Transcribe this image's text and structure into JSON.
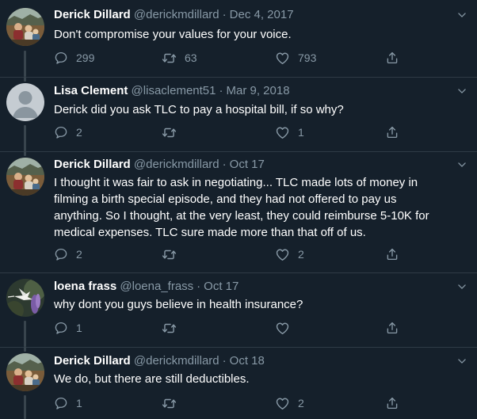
{
  "tweets": [
    {
      "display_name": "Derick Dillard",
      "handle": "@derickmdillard",
      "separator": "·",
      "date": "Dec 4, 2017",
      "text": "Don't compromise your values for your voice.",
      "replies": "299",
      "retweets": "63",
      "likes": "793",
      "avatar": "derick-avatar"
    },
    {
      "display_name": "Lisa Clement",
      "handle": "@lisaclement51",
      "separator": "·",
      "date": "Mar 9, 2018",
      "text": "Derick did you ask TLC to pay a hospital bill, if so why?",
      "replies": "2",
      "retweets": "",
      "likes": "1",
      "avatar": "default-avatar"
    },
    {
      "display_name": "Derick Dillard",
      "handle": "@derickmdillard",
      "separator": "·",
      "date": "Oct 17",
      "text": "I thought it was fair to ask in negotiating... TLC made lots of money in\nfilming a birth special episode, and they had not offered to pay us\nanything.  So I thought, at the very least, they could reimburse 5-10K for\nmedical expenses.  TLC sure made more than that off of us.",
      "replies": "2",
      "retweets": "",
      "likes": "2",
      "avatar": "derick-avatar"
    },
    {
      "display_name": "loena frass",
      "handle": "@loena_frass",
      "separator": "·",
      "date": "Oct 17",
      "text": "why dont you guys believe in health insurance?",
      "replies": "1",
      "retweets": "",
      "likes": "",
      "avatar": "hummingbird-avatar"
    },
    {
      "display_name": "Derick Dillard",
      "handle": "@derickmdillard",
      "separator": "·",
      "date": "Oct 18",
      "text": "We do, but there are still deductibles.",
      "replies": "1",
      "retweets": "",
      "likes": "2",
      "avatar": "derick-avatar"
    }
  ],
  "icons": {
    "reply": "reply-icon",
    "retweet": "retweet-icon",
    "like": "heart-icon",
    "share": "share-icon",
    "menu": "chevron-down-icon"
  },
  "colors": {
    "background": "#15202b",
    "muted_text": "#8899a6",
    "thread_line": "#38444d",
    "divider": "#2f3b46",
    "text": "#ffffff"
  }
}
